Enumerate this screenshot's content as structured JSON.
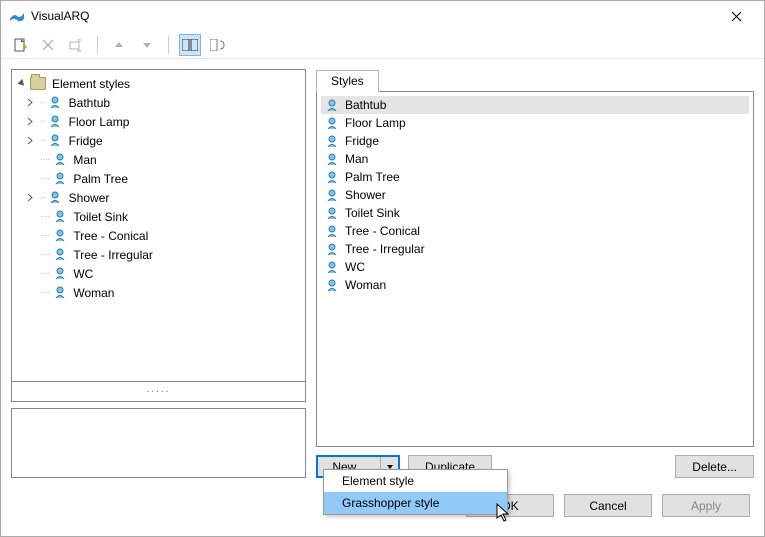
{
  "window": {
    "title": "VisualARQ"
  },
  "toolbar": {
    "buttons": [
      "new",
      "delete",
      "rename",
      "up",
      "down",
      "layout1",
      "layout2"
    ]
  },
  "tree": {
    "root": "Element styles",
    "items": [
      {
        "label": "Bathtub",
        "expandable": true
      },
      {
        "label": "Floor Lamp",
        "expandable": true
      },
      {
        "label": "Fridge",
        "expandable": true
      },
      {
        "label": "Man",
        "expandable": false
      },
      {
        "label": "Palm Tree",
        "expandable": false
      },
      {
        "label": "Shower",
        "expandable": true
      },
      {
        "label": "Toilet Sink",
        "expandable": false
      },
      {
        "label": "Tree - Conical",
        "expandable": false
      },
      {
        "label": "Tree - Irregular",
        "expandable": false
      },
      {
        "label": "WC",
        "expandable": false
      },
      {
        "label": "Woman",
        "expandable": false
      }
    ]
  },
  "tabs": {
    "styles": "Styles"
  },
  "list": {
    "items": [
      "Bathtub",
      "Floor Lamp",
      "Fridge",
      "Man",
      "Palm Tree",
      "Shower",
      "Toilet Sink",
      "Tree - Conical",
      "Tree - Irregular",
      "WC",
      "Woman"
    ],
    "selected": 0
  },
  "buttons": {
    "new": "New...",
    "duplicate": "Duplicate",
    "delete": "Delete...",
    "ok": "OK",
    "cancel": "Cancel",
    "apply": "Apply"
  },
  "dropdown": {
    "item1": "Element style",
    "item2": "Grasshopper style",
    "highlighted": 1
  },
  "resizer": "....."
}
